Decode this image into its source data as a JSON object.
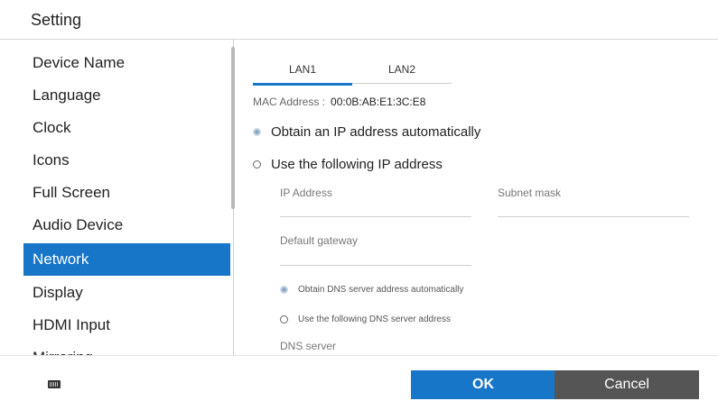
{
  "window": {
    "title": "Setting"
  },
  "sidebar": {
    "items": [
      {
        "label": "Device Name",
        "active": false
      },
      {
        "label": "Language",
        "active": false
      },
      {
        "label": "Clock",
        "active": false
      },
      {
        "label": "Icons",
        "active": false
      },
      {
        "label": "Full Screen",
        "active": false
      },
      {
        "label": "Audio Device",
        "active": false
      },
      {
        "label": "Network",
        "active": true
      },
      {
        "label": "Display",
        "active": false
      },
      {
        "label": "HDMI Input",
        "active": false
      },
      {
        "label": "Mirroring",
        "active": false
      }
    ]
  },
  "network": {
    "tabs": [
      {
        "label": "LAN1",
        "selected": true
      },
      {
        "label": "LAN2",
        "selected": false
      }
    ],
    "mac_label": "MAC Address :",
    "mac_value": "00:0B:AB:E1:3C:E8",
    "ip_auto_label": "Obtain an IP address automatically",
    "ip_manual_label": "Use the following IP address",
    "ip_mode": "auto",
    "ip_address_label": "IP Address",
    "ip_address_value": "",
    "subnet_label": "Subnet mask",
    "subnet_value": "",
    "gateway_label": "Default gateway",
    "gateway_value": "",
    "dns_auto_label": "Obtain DNS server address automatically",
    "dns_manual_label": "Use the following DNS server address",
    "dns_mode": "auto",
    "dns_server_label": "DNS server"
  },
  "footer": {
    "keyboard_icon": "keyboard-icon",
    "ok_label": "OK",
    "cancel_label": "Cancel"
  },
  "colors": {
    "accent": "#1776c8",
    "cancel": "#555555"
  }
}
